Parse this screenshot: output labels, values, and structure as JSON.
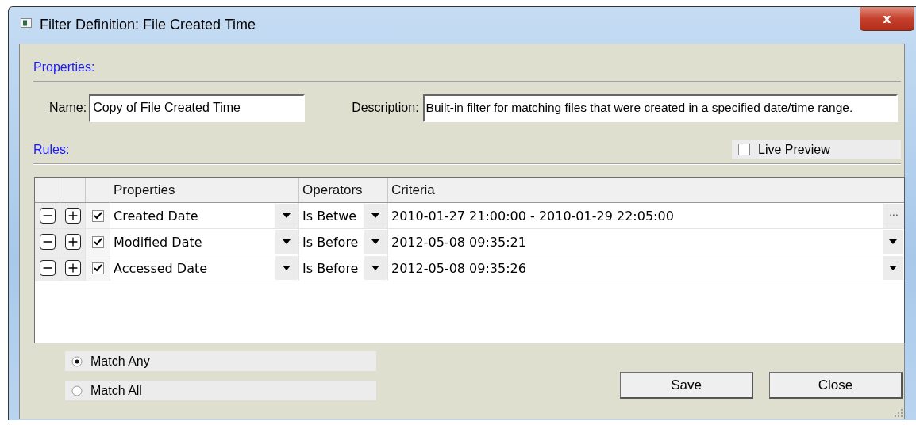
{
  "window": {
    "title": "Filter Definition: File Created Time",
    "close_label": "x"
  },
  "properties": {
    "heading": "Properties:",
    "name_label": "Name:",
    "name_value": "Copy of File Created Time",
    "description_label": "Description:",
    "description_value": "Built-in filter for matching files that were created in a specified date/time range."
  },
  "rules": {
    "heading": "Rules:",
    "live_preview": {
      "label": "Live Preview",
      "checked": false
    },
    "columns": [
      "Properties",
      "Operators",
      "Criteria"
    ],
    "rows": [
      {
        "checked": true,
        "property": "Created Date",
        "operator": "Is Betwe",
        "criteria": "2010-01-27 21:00:00 - 2010-01-29 22:05:00",
        "kind": "ellipsis",
        "button_text": "···"
      },
      {
        "checked": true,
        "property": "Modified Date",
        "operator": "Is Before",
        "criteria": "2012-05-08 09:35:21",
        "kind": "dropdown"
      },
      {
        "checked": true,
        "property": "Accessed Date",
        "operator": "Is Before",
        "criteria": "2012-05-08 09:35:26",
        "kind": "dropdown"
      }
    ]
  },
  "match": [
    {
      "label": "Match Any",
      "selected": true
    },
    {
      "label": "Match All",
      "selected": false
    }
  ],
  "buttons": [
    "Save",
    "Close"
  ]
}
